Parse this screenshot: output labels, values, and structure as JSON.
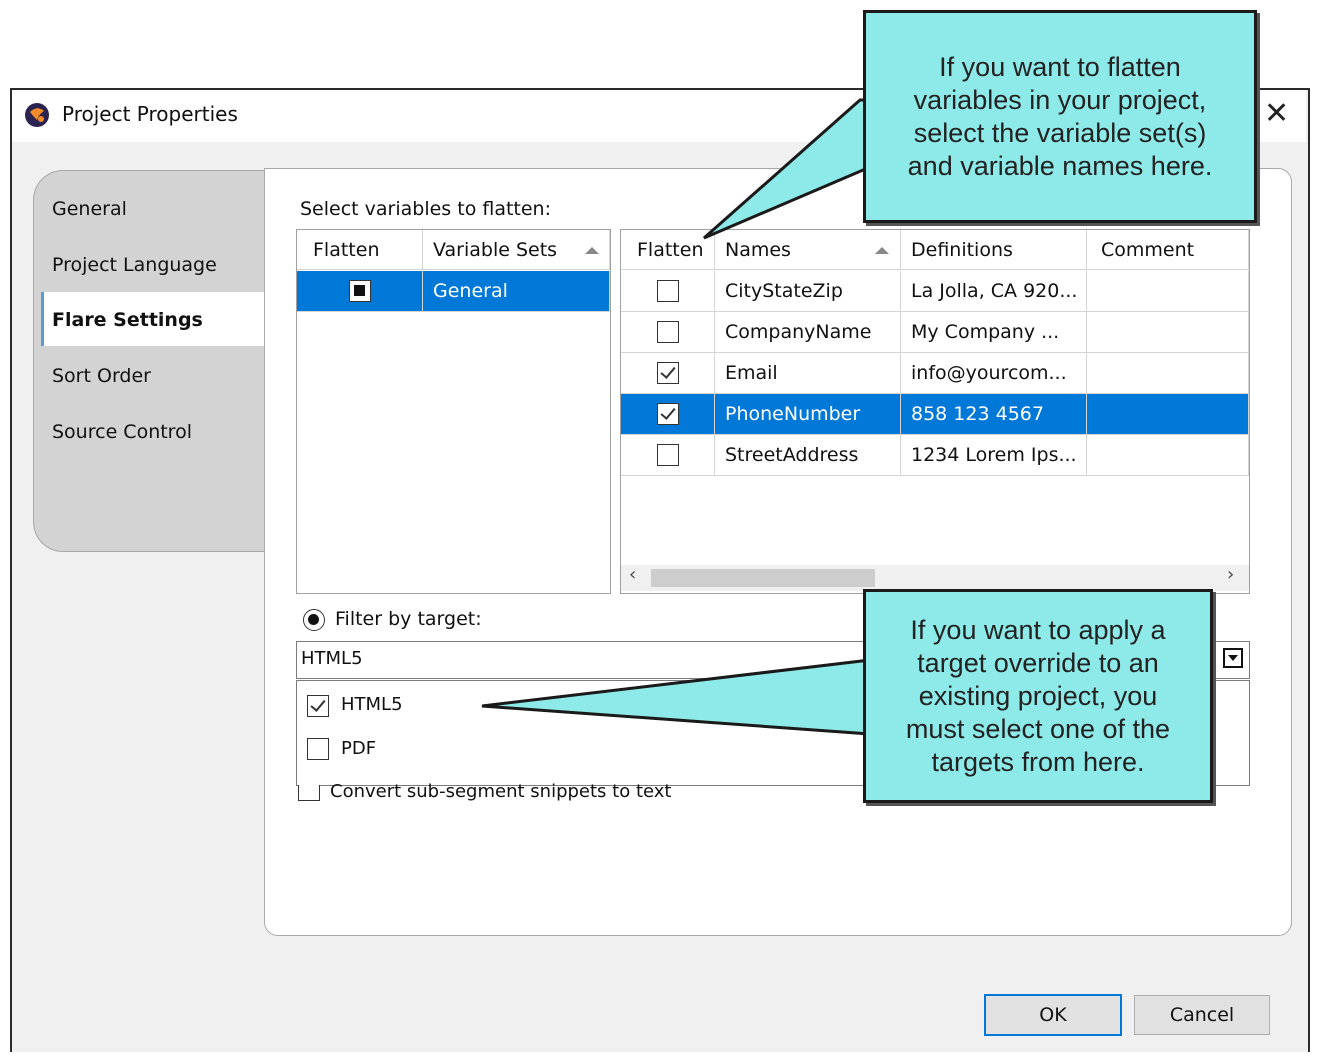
{
  "window": {
    "title": "Project Properties"
  },
  "tabs": [
    {
      "label": "General"
    },
    {
      "label": "Project Language"
    },
    {
      "label": "Flare Settings"
    },
    {
      "label": "Sort Order"
    },
    {
      "label": "Source Control"
    }
  ],
  "flatten_label": "Select variables to flatten:",
  "sets_table": {
    "headers": [
      "Flatten",
      "Variable Sets"
    ],
    "rows": [
      {
        "set": "General",
        "selected": true
      }
    ]
  },
  "vars_table": {
    "headers": [
      "Flatten",
      "Names",
      "Definitions",
      "Comment"
    ],
    "rows": [
      {
        "name": "CityStateZip",
        "definition": "La Jolla, CA 920...",
        "comment": "",
        "checked": false
      },
      {
        "name": "CompanyName",
        "definition": "My Company ...",
        "comment": "",
        "checked": false
      },
      {
        "name": "Email",
        "definition": "info@yourcom...",
        "comment": "",
        "checked": true
      },
      {
        "name": "PhoneNumber",
        "definition": "858 123 4567",
        "comment": "",
        "checked": true,
        "selected": true
      },
      {
        "name": "StreetAddress",
        "definition": "1234 Lorem Ips...",
        "comment": "",
        "checked": false
      }
    ]
  },
  "filter": {
    "label": "Filter by target:",
    "value": "HTML5",
    "options": [
      {
        "label": "HTML5",
        "checked": true
      },
      {
        "label": "PDF",
        "checked": false
      }
    ]
  },
  "convert_label": "Convert sub-segment snippets to text",
  "buttons": {
    "ok": "OK",
    "cancel": "Cancel"
  },
  "callouts": {
    "top": [
      "If you want to flatten",
      "variables in your project,",
      "select the variable set(s)",
      "and variable names here."
    ],
    "bottom": [
      "If you want to apply a",
      "target override to an",
      "existing project, you",
      "must select one of the",
      "targets from here."
    ]
  },
  "colors": {
    "selection": "#0078d7",
    "callout": "#8eeae9"
  }
}
